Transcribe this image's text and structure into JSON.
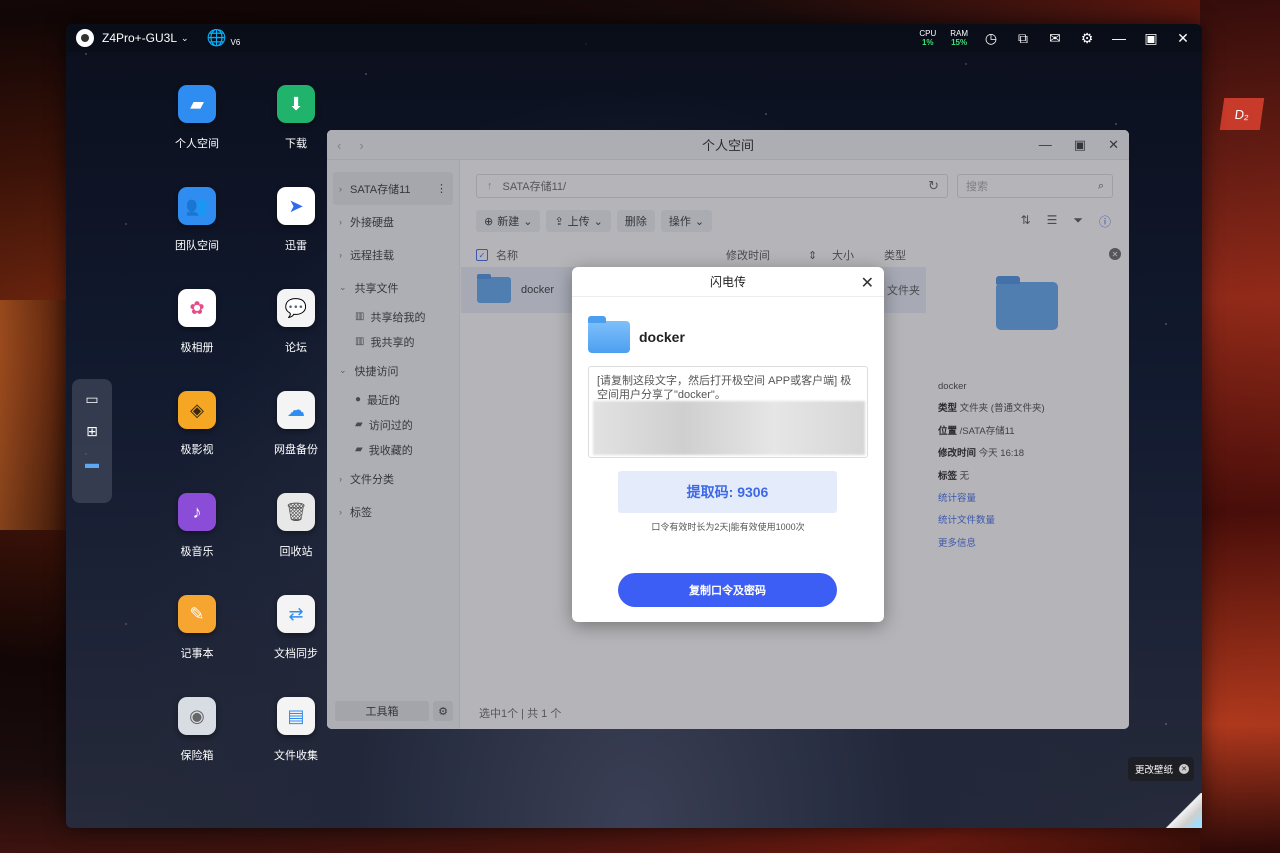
{
  "topbar": {
    "device_name": "Z4Pro+-GU3L",
    "ipv6_badge": "V6",
    "cpu_label": "CPU",
    "cpu_value": "1%",
    "ram_label": "RAM",
    "ram_value": "15%"
  },
  "desktop_icons": [
    {
      "label": "个人空间",
      "icon": "folder-icon",
      "color": "#2f8cf0"
    },
    {
      "label": "下载",
      "icon": "download-icon",
      "color": "#1fb36b"
    },
    {
      "label": "团队空间",
      "icon": "team-folder-icon",
      "color": "#2f8cf0"
    },
    {
      "label": "迅雷",
      "icon": "thunder-icon",
      "color": "#ffffff"
    },
    {
      "label": "极相册",
      "icon": "photos-icon",
      "color": "#ffffff"
    },
    {
      "label": "论坛",
      "icon": "forum-icon",
      "color": "#f4f4f4"
    },
    {
      "label": "极影视",
      "icon": "video-icon",
      "color": "#f5a623"
    },
    {
      "label": "网盘备份",
      "icon": "cloud-backup-icon",
      "color": "#f4f4f4"
    },
    {
      "label": "极音乐",
      "icon": "music-icon",
      "color": "#8b4cd8"
    },
    {
      "label": "回收站",
      "icon": "trash-icon",
      "color": "#e8e8e8"
    },
    {
      "label": "记事本",
      "icon": "notepad-icon",
      "color": "#f7a531"
    },
    {
      "label": "文档同步",
      "icon": "sync-icon",
      "color": "#f4f4f4"
    },
    {
      "label": "保险箱",
      "icon": "safe-icon",
      "color": "#d8dde3"
    },
    {
      "label": "文件收集",
      "icon": "file-collect-icon",
      "color": "#f4f4f4"
    }
  ],
  "file_manager": {
    "title": "个人空间",
    "sidebar": {
      "storage": "SATA存储11",
      "external": "外接硬盘",
      "remote": "远程挂载",
      "shared": "共享文件",
      "shared_to_me": "共享给我的",
      "my_shared": "我共享的",
      "quick": "快捷访问",
      "recent": "最近的",
      "visited": "访问过的",
      "favorites": "我收藏的",
      "categories": "文件分类",
      "tags": "标签",
      "toolbox": "工具箱"
    },
    "path": "SATA存储11/",
    "search_placeholder": "搜索",
    "toolbar": {
      "new": "新建",
      "upload": "上传",
      "delete": "删除",
      "actions": "操作"
    },
    "columns": {
      "name": "名称",
      "modified": "修改时间",
      "size": "大小",
      "type": "类型"
    },
    "rows": [
      {
        "name": "docker",
        "type": "文件夹"
      }
    ],
    "details": {
      "name": "docker",
      "type_label": "类型",
      "type_value": "文件夹 (普通文件夹)",
      "location_label": "位置",
      "location_value": "/SATA存储11",
      "modified_label": "修改时间",
      "modified_value": "今天 16:18",
      "tags_label": "标签",
      "tags_value": "无",
      "link_capacity": "统计容量",
      "link_count": "统计文件数量",
      "link_more": "更多信息"
    },
    "status": "选中1个 | 共 1 个"
  },
  "dialog": {
    "title": "闪电传",
    "folder_name": "docker",
    "share_text": "[请复制这段文字，然后打开极空间 APP或客户端] 极空间用户分享了\"docker\"。",
    "code": "提取码: 9306",
    "validity": "口令有效时长为2天|能有效使用1000次",
    "copy_button": "复制口令及密码"
  },
  "wallpaper": {
    "change_label": "更改壁纸"
  },
  "colors": {
    "accent": "#3d5ef5",
    "link": "#3d68e8",
    "cpu_ram_value": "#3fe07a"
  }
}
